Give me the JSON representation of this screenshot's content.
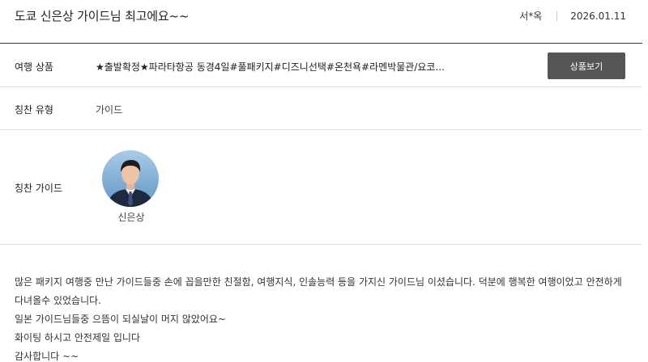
{
  "review": {
    "title": "도쿄 신은상 가이드님 최고에요~~",
    "author": "서*옥",
    "date": "2026.01.11"
  },
  "product": {
    "label": "여행 상품",
    "name": "★출발확정★파라타항공 동경4일#풀패키지#디즈니선택#온천욕#라멘박물관/요코...",
    "button_label": "상품보기"
  },
  "praise_type": {
    "label": "칭찬 유형",
    "value": "가이드"
  },
  "praise_guide": {
    "label": "칭찬 가이드",
    "name": "신은상"
  },
  "body_lines": [
    "많은 패키지 여행중 만난 가이드들중 손에 꼽을만한 친절함, 여행지식, 인솔능력 등을 가지신 가이드님 이셨습니다. 덕분에 행복한 여행이었고 안전하게",
    "다녀올수 있었습니다.",
    "일본 가이드님들중 으뜸이 되실날이 머지 않았어요~",
    "화이팅 하시고 안전제일 입니다",
    "감사합니다 ~~"
  ],
  "colors": {
    "button_bg": "#555555",
    "divider": "#e2e2e2"
  }
}
